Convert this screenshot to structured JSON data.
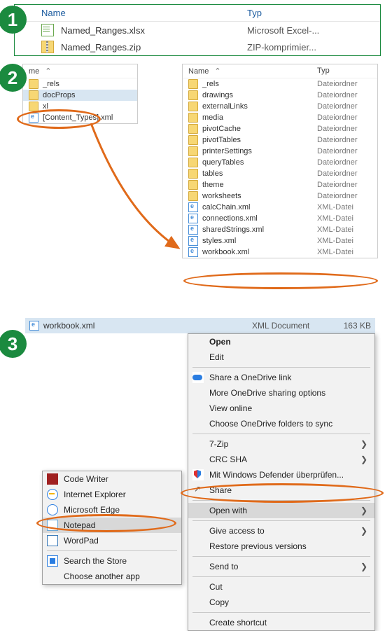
{
  "step1": {
    "header_name": "Name",
    "header_typ": "Typ",
    "rows": [
      {
        "icon": "excel",
        "name": "Named_Ranges.xlsx",
        "typ": "Microsoft Excel-..."
      },
      {
        "icon": "zip",
        "name": "Named_Ranges.zip",
        "typ": "ZIP-komprimier..."
      }
    ]
  },
  "step2a": {
    "header_name": "me",
    "rows": [
      {
        "icon": "folder",
        "name": "_rels",
        "selected": false
      },
      {
        "icon": "folder",
        "name": "docProps",
        "selected": true
      },
      {
        "icon": "folder",
        "name": "xl",
        "selected": false
      },
      {
        "icon": "xml",
        "name": "[Content_Types].xml",
        "selected": false
      }
    ]
  },
  "step2b": {
    "header_name": "Name",
    "header_typ": "Typ",
    "rows": [
      {
        "icon": "folder",
        "name": "_rels",
        "typ": "Dateiordner"
      },
      {
        "icon": "folder",
        "name": "drawings",
        "typ": "Dateiordner"
      },
      {
        "icon": "folder",
        "name": "externalLinks",
        "typ": "Dateiordner"
      },
      {
        "icon": "folder",
        "name": "media",
        "typ": "Dateiordner"
      },
      {
        "icon": "folder",
        "name": "pivotCache",
        "typ": "Dateiordner"
      },
      {
        "icon": "folder",
        "name": "pivotTables",
        "typ": "Dateiordner"
      },
      {
        "icon": "folder",
        "name": "printerSettings",
        "typ": "Dateiordner"
      },
      {
        "icon": "folder",
        "name": "queryTables",
        "typ": "Dateiordner"
      },
      {
        "icon": "folder",
        "name": "tables",
        "typ": "Dateiordner"
      },
      {
        "icon": "folder",
        "name": "theme",
        "typ": "Dateiordner"
      },
      {
        "icon": "folder",
        "name": "worksheets",
        "typ": "Dateiordner"
      },
      {
        "icon": "xml",
        "name": "calcChain.xml",
        "typ": "XML-Datei"
      },
      {
        "icon": "xml",
        "name": "connections.xml",
        "typ": "XML-Datei"
      },
      {
        "icon": "xml",
        "name": "sharedStrings.xml",
        "typ": "XML-Datei"
      },
      {
        "icon": "xml",
        "name": "styles.xml",
        "typ": "XML-Datei"
      },
      {
        "icon": "xml",
        "name": "workbook.xml",
        "typ": "XML-Datei"
      }
    ]
  },
  "step3": {
    "file": {
      "name": "workbook.xml",
      "type": "XML Document",
      "size": "163 KB"
    },
    "menu": [
      {
        "type": "item",
        "label": "Open",
        "bold": true
      },
      {
        "type": "item",
        "label": "Edit"
      },
      {
        "type": "sep"
      },
      {
        "type": "item",
        "label": "Share a OneDrive link",
        "icon": "onedrive"
      },
      {
        "type": "item",
        "label": "More OneDrive sharing options"
      },
      {
        "type": "item",
        "label": "View online"
      },
      {
        "type": "item",
        "label": "Choose OneDrive folders to sync"
      },
      {
        "type": "sep"
      },
      {
        "type": "item",
        "label": "7-Zip",
        "sub": true
      },
      {
        "type": "item",
        "label": "CRC SHA",
        "sub": true
      },
      {
        "type": "item",
        "label": "Mit Windows Defender überprüfen...",
        "icon": "shield"
      },
      {
        "type": "item",
        "label": "Share",
        "icon": "share"
      },
      {
        "type": "sep"
      },
      {
        "type": "item",
        "label": "Open with",
        "sub": true,
        "selected": true
      },
      {
        "type": "sep"
      },
      {
        "type": "item",
        "label": "Give access to",
        "sub": true
      },
      {
        "type": "item",
        "label": "Restore previous versions"
      },
      {
        "type": "sep"
      },
      {
        "type": "item",
        "label": "Send to",
        "sub": true
      },
      {
        "type": "sep"
      },
      {
        "type": "item",
        "label": "Cut"
      },
      {
        "type": "item",
        "label": "Copy"
      },
      {
        "type": "sep"
      },
      {
        "type": "item",
        "label": "Create shortcut"
      }
    ],
    "submenu": [
      {
        "label": "Code Writer",
        "icon": "codewriter"
      },
      {
        "label": "Internet Explorer",
        "icon": "ie"
      },
      {
        "label": "Microsoft Edge",
        "icon": "edge"
      },
      {
        "label": "Notepad",
        "icon": "notepad",
        "selected": true
      },
      {
        "label": "WordPad",
        "icon": "wordpad"
      },
      {
        "label": "Search the Store",
        "icon": "store",
        "sep_before": true
      },
      {
        "label": "Choose another app"
      }
    ]
  },
  "badges": {
    "b1": "1",
    "b2": "2",
    "b3": "3"
  },
  "sort_glyph": "⌃",
  "arrow_glyph": "❯"
}
